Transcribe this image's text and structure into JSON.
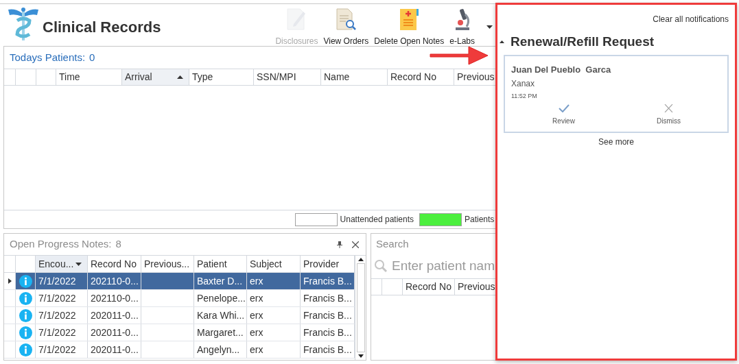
{
  "app": {
    "title": "Clinical Records"
  },
  "toolbar": [
    {
      "label": "Disclosures",
      "kind": "disclosures",
      "disabled": true
    },
    {
      "label": "View Orders",
      "kind": "orders",
      "disabled": false
    },
    {
      "label": "Delete Open Notes",
      "kind": "notes",
      "disabled": false
    },
    {
      "label": "e-Labs",
      "kind": "labs",
      "disabled": false
    }
  ],
  "todays_patients": {
    "title": "Todays Patients:",
    "count": "0",
    "columns": [
      {
        "label": "Time",
        "sorted_ascending": false,
        "sorted_descending": false
      },
      {
        "label": "Arrival",
        "sorted_ascending": true,
        "sorted_descending": false
      },
      {
        "label": "Type",
        "sorted_ascending": false,
        "sorted_descending": false
      },
      {
        "label": "SSN/MPI",
        "sorted_ascending": false,
        "sorted_descending": false
      },
      {
        "label": "Name",
        "sorted_ascending": false,
        "sorted_descending": false
      },
      {
        "label": "Record No",
        "sorted_ascending": false,
        "sorted_descending": false
      },
      {
        "label": "Previous",
        "sorted_ascending": false,
        "sorted_descending": false
      }
    ],
    "legend": [
      {
        "label": "Unattended patients",
        "color": "#ffffff"
      },
      {
        "label": "Patients",
        "color": "#4cef3e"
      }
    ]
  },
  "progress_notes": {
    "title": "Open Progress Notes:",
    "count": "8",
    "columns": [
      {
        "label": "Encou...",
        "sorted_ascending": false,
        "sorted_descending": true
      },
      {
        "label": "Record No",
        "sorted_ascending": false,
        "sorted_descending": false
      },
      {
        "label": "Previous...",
        "sorted_ascending": false,
        "sorted_descending": false
      },
      {
        "label": "Patient",
        "sorted_ascending": false,
        "sorted_descending": false
      },
      {
        "label": "Subject",
        "sorted_ascending": false,
        "sorted_descending": false
      },
      {
        "label": "Provider",
        "sorted_ascending": false,
        "sorted_descending": false
      }
    ],
    "rows": [
      {
        "selected": true,
        "encounter": "7/1/2022",
        "record_no": "202110-0...",
        "patient": "Baxter D...",
        "subject": "erx",
        "provider": "Francis B..."
      },
      {
        "selected": false,
        "encounter": "7/1/2022",
        "record_no": "202110-0...",
        "patient": "Penelope...",
        "subject": "erx",
        "provider": "Francis B..."
      },
      {
        "selected": false,
        "encounter": "7/1/2022",
        "record_no": "202011-0...",
        "patient": "Kara Whi...",
        "subject": "erx",
        "provider": "Francis B..."
      },
      {
        "selected": false,
        "encounter": "7/1/2022",
        "record_no": "202011-0...",
        "patient": "Margaret...",
        "subject": "erx",
        "provider": "Francis B..."
      },
      {
        "selected": false,
        "encounter": "7/1/2022",
        "record_no": "202011-0...",
        "patient": "Angelyn...",
        "subject": "erx",
        "provider": "Francis B..."
      }
    ]
  },
  "search": {
    "title": "Search",
    "placeholder": "Enter patient nam",
    "columns": [
      "Record No",
      "Previous"
    ]
  },
  "notifications": {
    "clear_label": "Clear all notifications",
    "sections": [
      {
        "title": "Renewal/Refill Request",
        "expanded": true,
        "items": [
          {
            "name": "Juan Del Pueblo  Garca",
            "drug": "Xanax",
            "time": "11:52 PM",
            "actions": [
              {
                "label": "Review",
                "kind": "review"
              },
              {
                "label": "Dismiss",
                "kind": "dismiss"
              }
            ]
          }
        ]
      }
    ],
    "see_more": "See more"
  }
}
